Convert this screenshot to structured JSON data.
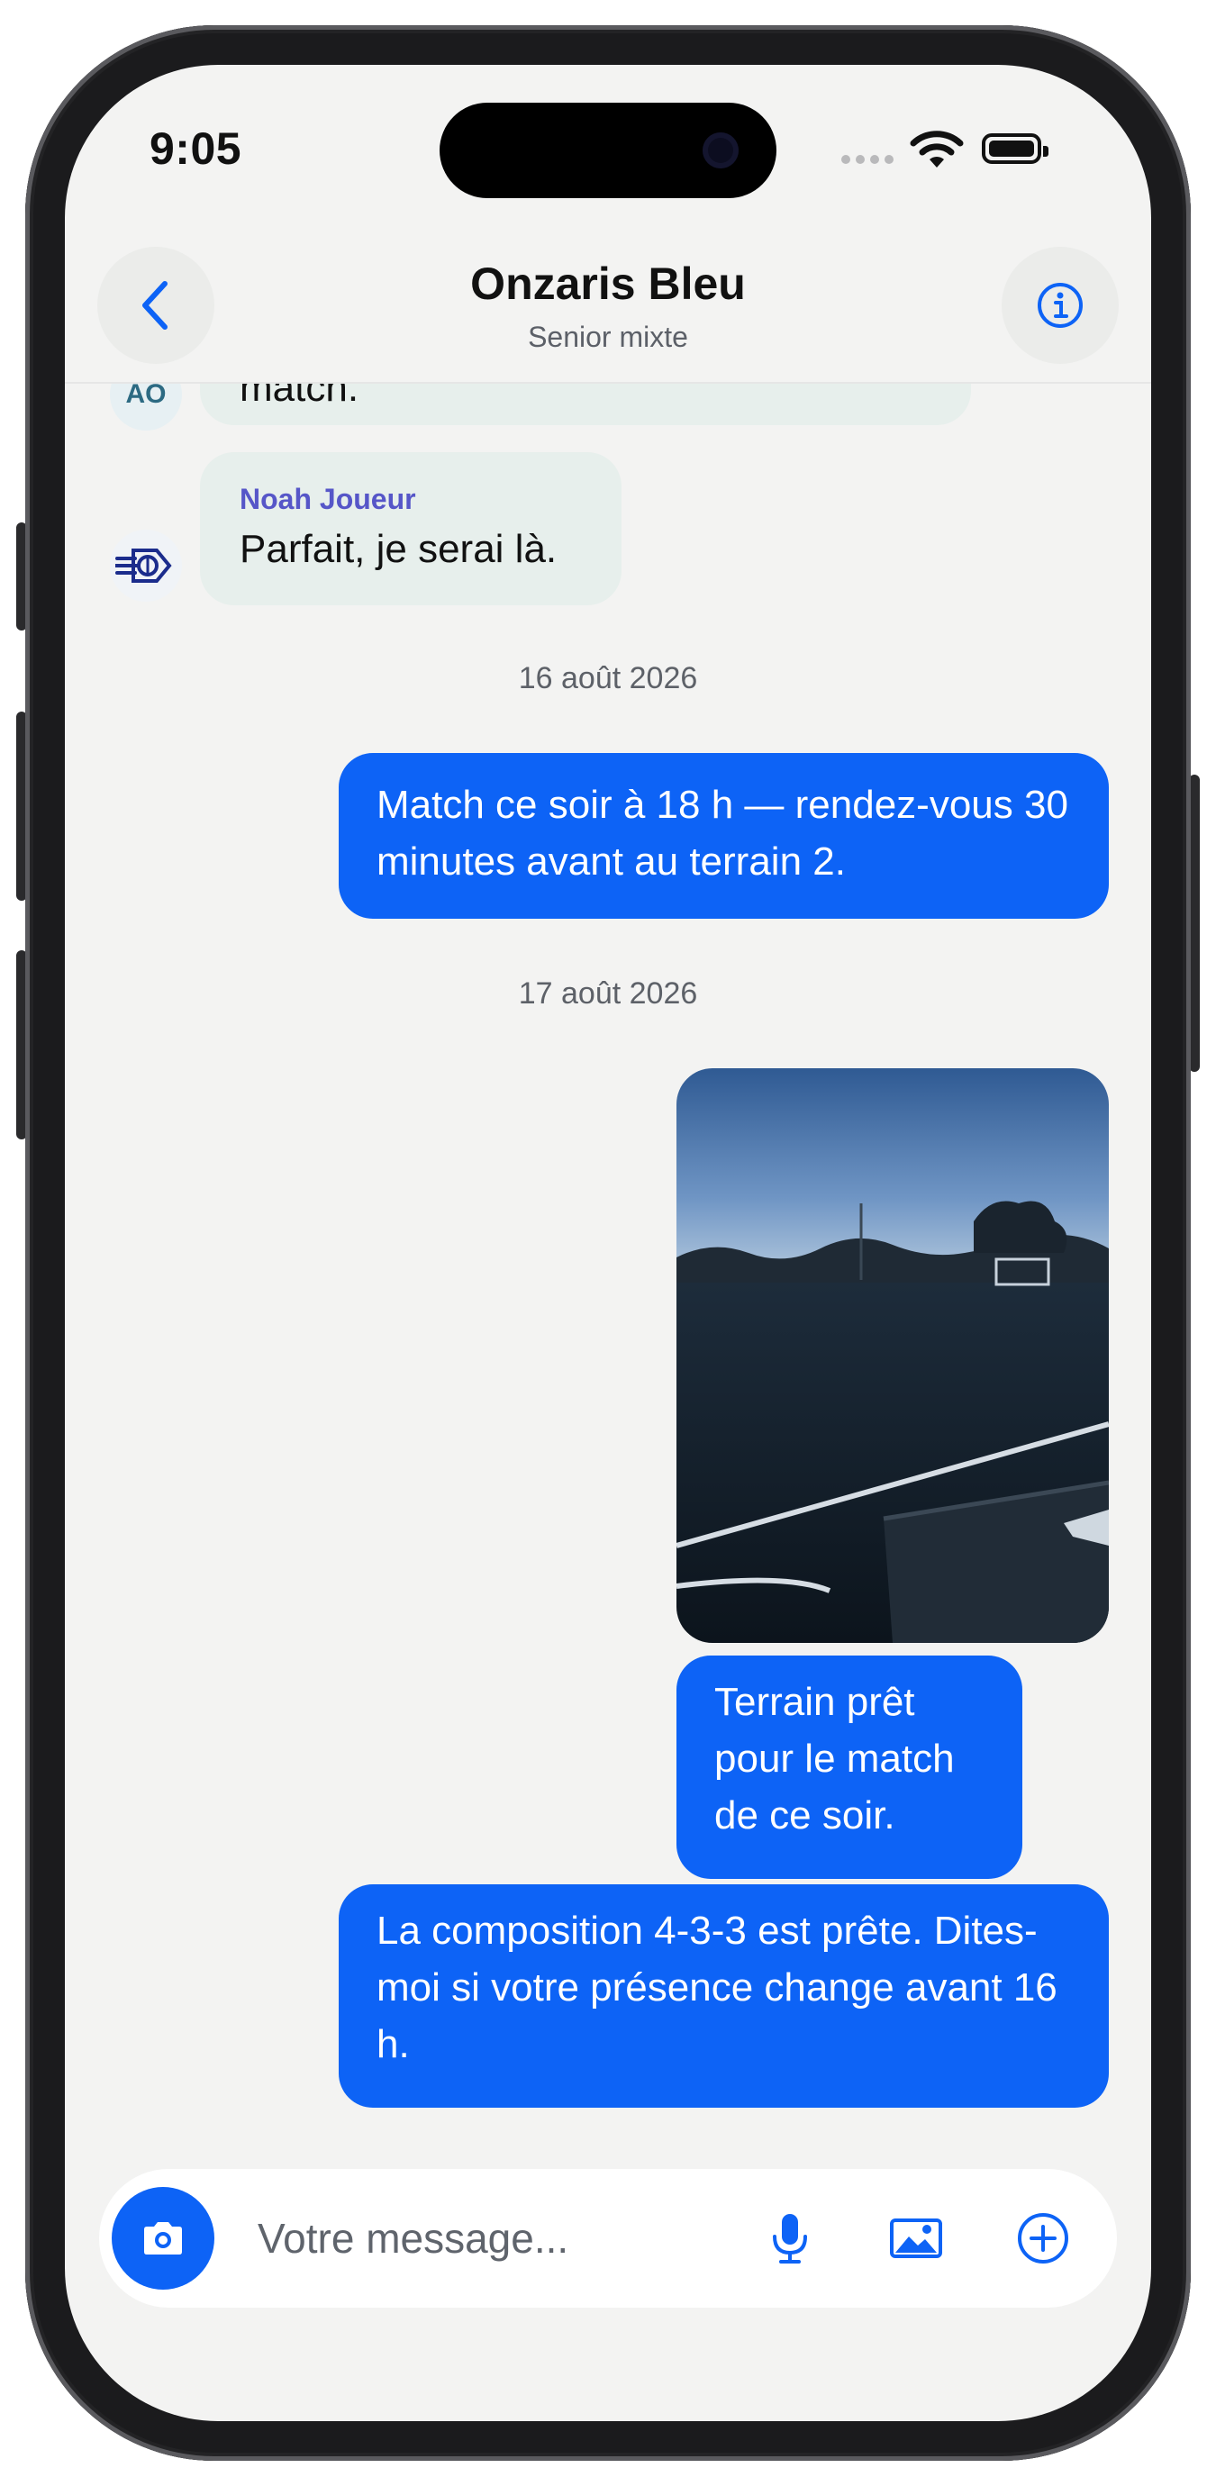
{
  "status_bar": {
    "time": "9:05"
  },
  "header": {
    "title": "Onzaris Bleu",
    "subtitle": "Senior mixte"
  },
  "messages": {
    "prev_partial": {
      "avatar_initials": "AO",
      "text": "match."
    },
    "incoming": {
      "sender": "Noah Joueur",
      "text": "Parfait, je serai là."
    },
    "date_1": "16 août 2026",
    "out_1": "Match ce soir à 18 h — rendez-vous 30 minutes avant au terrain 2.",
    "date_2": "17 août 2026",
    "out_2": "Terrain prêt pour le match de ce soir.",
    "out_3": "La composition 4-3-3 est prête. Dites-moi si votre présence change avant 16 h."
  },
  "composer": {
    "placeholder": "Votre message..."
  },
  "icons": {
    "back": "chevron-left-icon",
    "info": "info-icon",
    "camera": "camera-icon",
    "mic": "microphone-icon",
    "gallery": "image-icon",
    "add": "plus-circle-icon"
  },
  "colors": {
    "accent": "#0d63f6",
    "incoming_bubble": "#e7efec",
    "sender_name": "#5656c8"
  }
}
